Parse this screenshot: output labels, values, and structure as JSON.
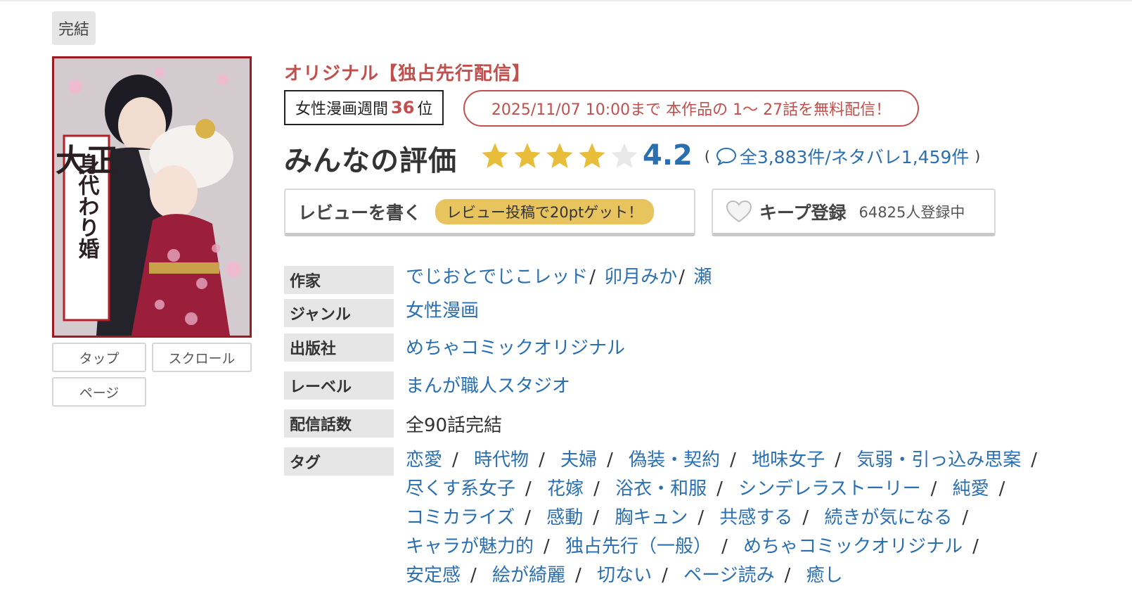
{
  "status_badge": "完結",
  "view_buttons": {
    "tap": "タップ",
    "scroll": "スクロール",
    "page": "ページ"
  },
  "cover": {
    "title_lines": [
      "大正",
      "身代わり婚"
    ]
  },
  "original_label": "オリジナル【独占先行配信】",
  "rank": {
    "prefix": "女性漫画週間",
    "number": "36",
    "suffix": "位"
  },
  "free_notice": "2025/11/07 10:00まで 本作品の 1〜 27話を無料配信！",
  "rating": {
    "title": "みんなの評価",
    "value": "4.2",
    "stars_filled": 4,
    "stars_total": 5,
    "open_paren": "(",
    "counts_text": "全3,883件/ネタバレ1,459件",
    "close_paren": ")"
  },
  "review_button": {
    "label": "レビューを書く",
    "pill": "レビュー投稿で20ptゲット！"
  },
  "keep_button": {
    "label": "キープ登録",
    "count": "64825人登録中"
  },
  "info": {
    "author": {
      "label": "作家",
      "values": [
        "でじおとでじこレッド",
        "卯月みか",
        "瀬"
      ]
    },
    "genre": {
      "label": "ジャンル",
      "value": "女性漫画"
    },
    "publisher": {
      "label": "出版社",
      "value": "めちゃコミックオリジナル"
    },
    "imprint": {
      "label": "レーベル",
      "value": "まんが職人スタジオ"
    },
    "episodes": {
      "label": "配信話数",
      "value": "全90話完結"
    },
    "tags": {
      "label": "タグ",
      "items": [
        "恋愛",
        "時代物",
        "夫婦",
        "偽装・契約",
        "地味女子",
        "気弱・引っ込み思案",
        "尽くす系女子",
        "花嫁",
        "浴衣・和服",
        "シンデレラストーリー",
        "純愛",
        "コミカライズ",
        "感動",
        "胸キュン",
        "共感する",
        "続きが気になる",
        "キャラが魅力的",
        "独占先行（一般）",
        "めちゃコミックオリジナル",
        "安定感",
        "絵が綺麗",
        "切ない",
        "ページ読み",
        "癒し"
      ]
    }
  },
  "colors": {
    "accent_red": "#c0504d",
    "link_blue": "#2a6fb0",
    "star_gold": "#e8bd3a",
    "pill_yellow": "#e8c45e"
  }
}
